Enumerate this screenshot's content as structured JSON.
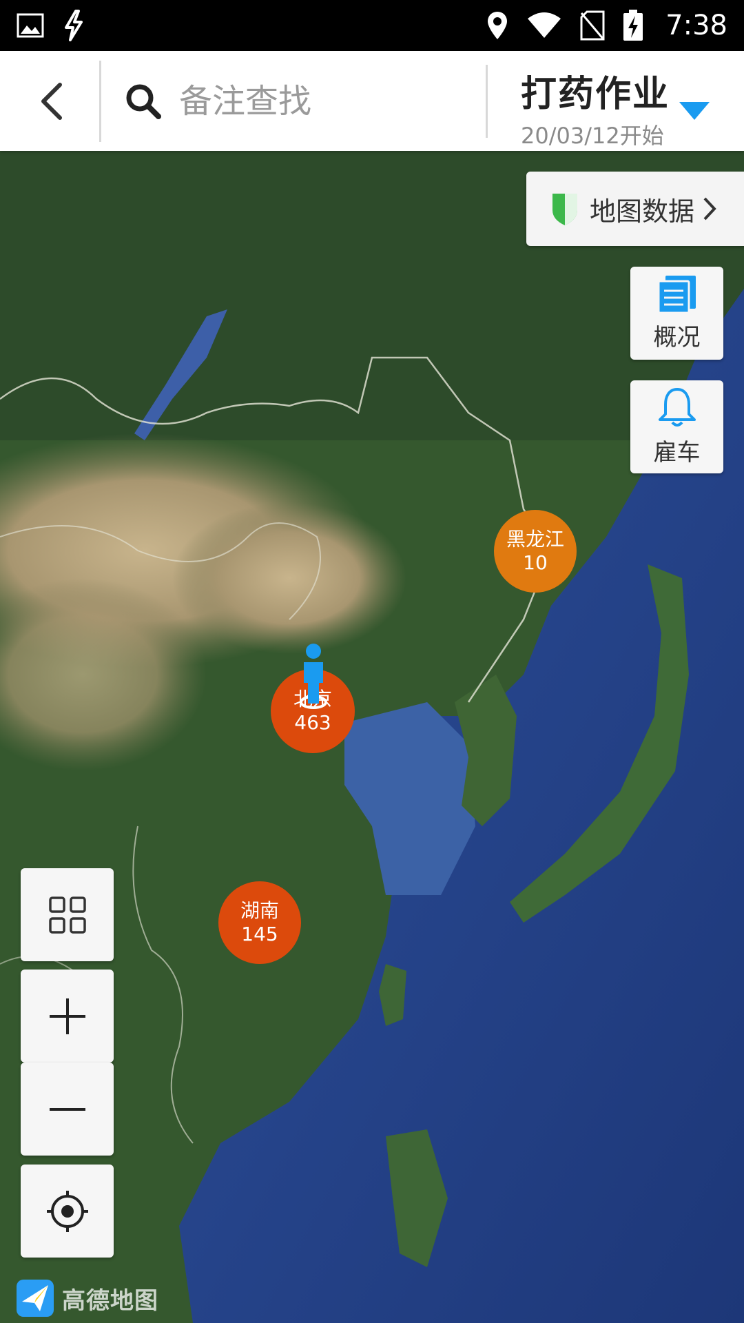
{
  "status_bar": {
    "time": "7:38",
    "left_icons": [
      "image-icon",
      "flash-icon"
    ],
    "right_icons": [
      "location-icon",
      "wifi-icon",
      "no-sim-icon",
      "battery-charging-icon"
    ]
  },
  "header": {
    "back_icon": "chevron-left-icon",
    "search": {
      "placeholder": "备注查找",
      "value": ""
    },
    "job": {
      "title": "打药作业",
      "subtitle": "20/03/12开始",
      "dropdown_color": "#1a9bf0"
    }
  },
  "map": {
    "map_data_button": {
      "label": "地图数据"
    },
    "side_buttons": [
      {
        "label": "概况",
        "icon": "document-icon"
      },
      {
        "label": "雇车",
        "icon": "bell-icon"
      }
    ],
    "clusters": [
      {
        "name": "黑龙江",
        "count": "10",
        "color": "#e07a10"
      },
      {
        "name": "北京",
        "count": "463",
        "color": "#dc4a0c"
      },
      {
        "name": "湖南",
        "count": "145",
        "color": "#dc4a0c"
      }
    ],
    "controls": [
      {
        "icon": "layers-grid-icon"
      },
      {
        "icon": "zoom-in-icon"
      },
      {
        "icon": "zoom-out-icon"
      },
      {
        "icon": "locate-icon"
      }
    ],
    "attribution": "高德地图"
  },
  "colors": {
    "accent": "#1a9bf0",
    "shield_green": "#3cb84a"
  }
}
